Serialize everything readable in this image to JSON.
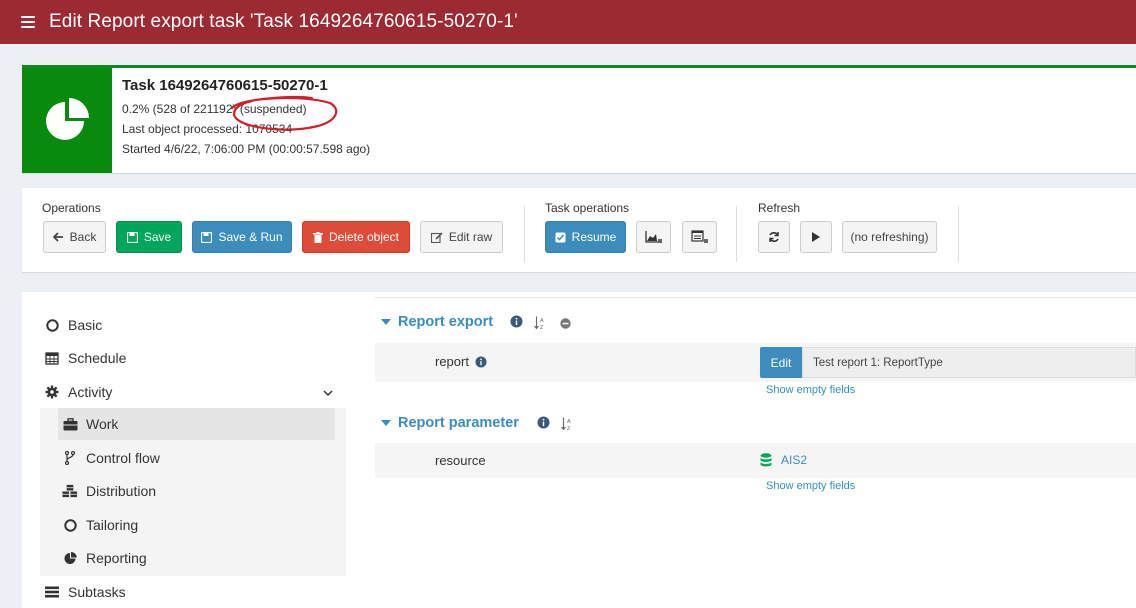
{
  "header": {
    "title": "Edit Report export task 'Task 1649264760615-50270-1'",
    "menu_icon": "hamburger-icon"
  },
  "summary": {
    "icon": "pie-chart-icon",
    "task_name": "Task 1649264760615-50270-1",
    "progress": "0.2% (528 of 221192) (suspended)",
    "last_object": "Last object processed: 1070534",
    "started": "Started 4/6/22, 7:06:00 PM (00:00:57.598 ago)",
    "accent_color": "#088b0c"
  },
  "operations": {
    "label": "Operations",
    "back": "Back",
    "save": "Save",
    "save_run": "Save & Run",
    "delete": "Delete object",
    "edit_raw": "Edit raw"
  },
  "task_operations": {
    "label": "Task operations",
    "resume": "Resume"
  },
  "refresh": {
    "label": "Refresh",
    "no_refreshing": "(no refreshing)"
  },
  "nav": {
    "basic": "Basic",
    "schedule": "Schedule",
    "activity": "Activity",
    "work": "Work",
    "control_flow": "Control flow",
    "distribution": "Distribution",
    "tailoring": "Tailoring",
    "reporting": "Reporting",
    "subtasks": "Subtasks"
  },
  "content": {
    "report_export": {
      "title": "Report export",
      "field_label": "report",
      "edit_button": "Edit",
      "value": "Test report 1: ReportType",
      "show_empty": "Show empty fields"
    },
    "report_parameter": {
      "title": "Report parameter",
      "field_label": "resource",
      "value": "AIS2",
      "show_empty": "Show empty fields"
    }
  },
  "colors": {
    "header_bg": "#9c2a32",
    "link_blue": "#3c8dbc",
    "annotation_red": "#d0202a"
  }
}
